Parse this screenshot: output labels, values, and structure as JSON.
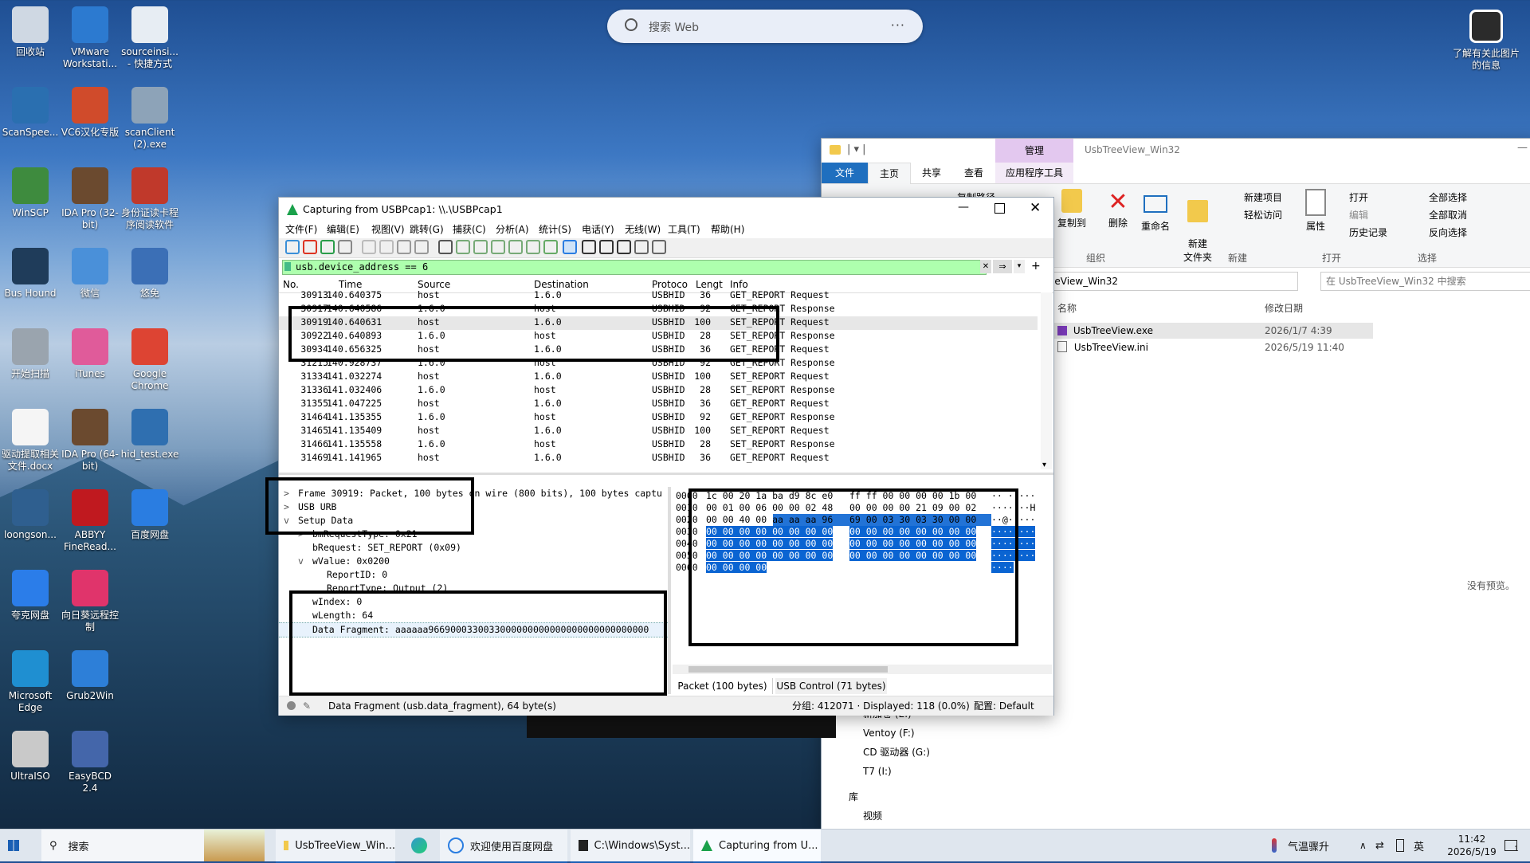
{
  "desktop": {
    "icons": [
      {
        "label": "回收站"
      },
      {
        "label": "VMware Workstati..."
      },
      {
        "label": "sourceinsi... - 快捷方式"
      },
      {
        "label": "ScanSpee..."
      },
      {
        "label": "VC6汉化专版"
      },
      {
        "label": "scanClient (2).exe"
      },
      {
        "label": "WinSCP"
      },
      {
        "label": "IDA Pro (32-bit)"
      },
      {
        "label": "身份证读卡程序阅读软件"
      },
      {
        "label": "Bus Hound"
      },
      {
        "label": "微信"
      },
      {
        "label": "悠免"
      },
      {
        "label": "开始扫描"
      },
      {
        "label": "iTunes"
      },
      {
        "label": "Google Chrome"
      },
      {
        "label": "驱动提取相关文件.docx"
      },
      {
        "label": "IDA Pro (64-bit)"
      },
      {
        "label": "hid_test.exe"
      },
      {
        "label": "loongson..."
      },
      {
        "label": "ABBYY FineRead..."
      },
      {
        "label": "百度网盘"
      },
      {
        "label": "夸克网盘"
      },
      {
        "label": "向日葵远程控制"
      },
      {
        "label": "Microsoft Edge"
      },
      {
        "label": "Grub2Win"
      },
      {
        "label": "UltraISO"
      },
      {
        "label": "EasyBCD 2.4"
      }
    ],
    "web_search_placeholder": "搜索 Web",
    "web_search_more": "···",
    "spotlight_label": "了解有关此图片的信息",
    "no_preview": "没有预览。"
  },
  "explorer": {
    "title": "UsbTreeView_Win32",
    "manage_tab": "管理",
    "tabs": [
      "文件",
      "主页",
      "共享",
      "查看",
      "应用程序工具"
    ],
    "ribbon": {
      "copy_path": "复制路径",
      "copy_to": "复制到",
      "delete": "删除",
      "rename": "重命名",
      "new_folder": "新建\n文件夹",
      "new_item": "新建项目",
      "easy_access": "轻松访问",
      "properties": "属性",
      "open": "打开",
      "edit": "编辑",
      "history": "历史记录",
      "select_all": "全部选择",
      "select_none": "全部取消",
      "invert": "反向选择",
      "groups": [
        "组织",
        "新建",
        "打开",
        "选择"
      ]
    },
    "address": "eeView_Win32",
    "search_placeholder": "在 UsbTreeView_Win32 中搜索",
    "columns": {
      "name": "名称",
      "modified": "修改日期"
    },
    "files": [
      {
        "name": "UsbTreeView.exe",
        "date": "2026/1/7 4:39"
      },
      {
        "name": "UsbTreeView.ini",
        "date": "2026/5/19 11:40"
      }
    ],
    "nav": [
      "新加卷 (E:)",
      "Ventoy (F:)",
      "CD 驱动器 (G:)",
      "T7 (I:)",
      "库",
      "视频"
    ]
  },
  "wireshark": {
    "title": "Capturing from USBPcap1: \\\\.\\USBPcap1",
    "menu": [
      "文件(F)",
      "编辑(E)",
      "视图(V)",
      "跳转(G)",
      "捕获(C)",
      "分析(A)",
      "统计(S)",
      "电话(Y)",
      "无线(W)",
      "工具(T)",
      "帮助(H)"
    ],
    "filter": "usb.device_address == 6",
    "columns": [
      "No.",
      "Time",
      "Source",
      "Destination",
      "Protoco",
      "Lengt",
      "Info"
    ],
    "packets": [
      {
        "no": "30913",
        "time": "140.640375",
        "src": "host",
        "dst": "1.6.0",
        "proto": "USBHID",
        "len": "36",
        "info": "GET_REPORT Request"
      },
      {
        "no": "30917",
        "time": "140.640586",
        "src": "1.6.0",
        "dst": "host",
        "proto": "USBHID",
        "len": "92",
        "info": "GET_REPORT Response"
      },
      {
        "no": "30919",
        "time": "140.640631",
        "src": "host",
        "dst": "1.6.0",
        "proto": "USBHID",
        "len": "100",
        "info": "SET_REPORT Request"
      },
      {
        "no": "30922",
        "time": "140.640893",
        "src": "1.6.0",
        "dst": "host",
        "proto": "USBHID",
        "len": "28",
        "info": "SET_REPORT Response"
      },
      {
        "no": "30934",
        "time": "140.656325",
        "src": "host",
        "dst": "1.6.0",
        "proto": "USBHID",
        "len": "36",
        "info": "GET_REPORT Request"
      },
      {
        "no": "31215",
        "time": "140.928737",
        "src": "1.6.0",
        "dst": "host",
        "proto": "USBHID",
        "len": "92",
        "info": "GET_REPORT Response"
      },
      {
        "no": "31334",
        "time": "141.032274",
        "src": "host",
        "dst": "1.6.0",
        "proto": "USBHID",
        "len": "100",
        "info": "SET_REPORT Request"
      },
      {
        "no": "31336",
        "time": "141.032406",
        "src": "1.6.0",
        "dst": "host",
        "proto": "USBHID",
        "len": "28",
        "info": "SET_REPORT Response"
      },
      {
        "no": "31355",
        "time": "141.047225",
        "src": "host",
        "dst": "1.6.0",
        "proto": "USBHID",
        "len": "36",
        "info": "GET_REPORT Request"
      },
      {
        "no": "31464",
        "time": "141.135355",
        "src": "1.6.0",
        "dst": "host",
        "proto": "USBHID",
        "len": "92",
        "info": "GET_REPORT Response"
      },
      {
        "no": "31465",
        "time": "141.135409",
        "src": "host",
        "dst": "1.6.0",
        "proto": "USBHID",
        "len": "100",
        "info": "SET_REPORT Request"
      },
      {
        "no": "31466",
        "time": "141.135558",
        "src": "1.6.0",
        "dst": "host",
        "proto": "USBHID",
        "len": "28",
        "info": "SET_REPORT Response"
      },
      {
        "no": "31469",
        "time": "141.141965",
        "src": "host",
        "dst": "1.6.0",
        "proto": "USBHID",
        "len": "36",
        "info": "GET_REPORT Request"
      }
    ],
    "details": [
      {
        "indent": 0,
        "arrow": ">",
        "text": "Frame 30919: Packet, 100 bytes on wire (800 bits), 100 bytes captu"
      },
      {
        "indent": 0,
        "arrow": ">",
        "text": "USB URB"
      },
      {
        "indent": 0,
        "arrow": "v",
        "text": "Setup Data"
      },
      {
        "indent": 1,
        "arrow": ">",
        "text": "bmRequestType: 0x21"
      },
      {
        "indent": 1,
        "arrow": "",
        "text": "bRequest: SET_REPORT (0x09)"
      },
      {
        "indent": 1,
        "arrow": "v",
        "text": "wValue: 0x0200"
      },
      {
        "indent": 2,
        "arrow": "",
        "text": "ReportID: 0"
      },
      {
        "indent": 2,
        "arrow": "",
        "text": "ReportType: Output (2)"
      },
      {
        "indent": 1,
        "arrow": "",
        "text": "wIndex: 0"
      },
      {
        "indent": 1,
        "arrow": "",
        "text": "wLength: 64"
      },
      {
        "indent": 1,
        "arrow": "",
        "text": "Data Fragment: aaaaaa9669000330033000000000000000000000000000"
      }
    ],
    "hex": [
      {
        "off": "0000",
        "a": "1c 00 20 1a ba d9 8c e0",
        "b": "ff ff 00 00 00 00 1b 00",
        "asc": "·· ·····"
      },
      {
        "off": "0010",
        "a": "00 01 00 06 00 00 02 48",
        "b": "00 00 00 00 21 09 00 02",
        "asc": "·······H"
      },
      {
        "off": "0020",
        "a": "00 00 40 00 aa aa aa 96",
        "b": "69 00 03 30 03 30 00 00",
        "asc": "··@·····"
      },
      {
        "off": "0030",
        "a": "00 00 00 00 00 00 00 00",
        "b": "00 00 00 00 00 00 00 00",
        "asc": "········"
      },
      {
        "off": "0040",
        "a": "00 00 00 00 00 00 00 00",
        "b": "00 00 00 00 00 00 00 00",
        "asc": "········"
      },
      {
        "off": "0050",
        "a": "00 00 00 00 00 00 00 00",
        "b": "00 00 00 00 00 00 00 00",
        "asc": "········"
      },
      {
        "off": "0060",
        "a": "00 00 00 00",
        "b": "",
        "asc": "····"
      }
    ],
    "bytes_tabs": [
      "Packet (100 bytes)",
      "USB Control (71 bytes)"
    ],
    "status_left": "Data Fragment (usb.data_fragment), 64 byte(s)",
    "status_mid": "分组: 412071 · Displayed: 118 (0.0%)",
    "status_profile": "配置: Default"
  },
  "taskbar": {
    "search": "搜索",
    "apps": [
      "UsbTreeView_Win...",
      "欢迎使用百度网盘",
      "C:\\Windows\\Syst...",
      "Capturing from U..."
    ],
    "weather": "气温骤升",
    "ime": "英",
    "time": "11:42",
    "date": "2026/5/19",
    "notif_count": "1"
  },
  "colors": {
    "filter_ok": "#aeffae",
    "selected_row": "#e7e7e7",
    "hex_select": "#0a64d2",
    "ribbon_file": "#1f6fbf"
  }
}
